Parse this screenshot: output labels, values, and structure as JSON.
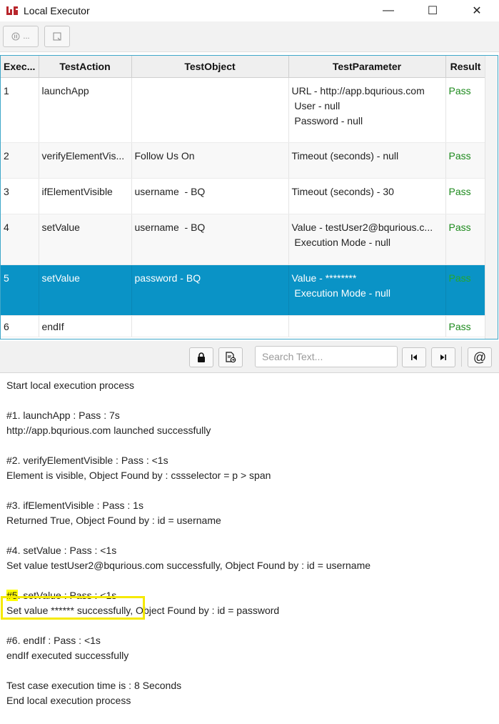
{
  "window": {
    "title": "Local Executor",
    "controls": [
      "—",
      "☐",
      "✕"
    ]
  },
  "toolbar": {
    "pause_label": "...",
    "save_icon": "save-icon"
  },
  "table": {
    "headers": [
      "Exec...",
      "TestAction",
      "TestObject",
      "TestParameter",
      "Result"
    ],
    "rows": [
      {
        "exec": "1",
        "action": "launchApp",
        "object": "",
        "params": [
          "URL - http://app.bqurious.com",
          " User - null",
          " Password - null"
        ],
        "result": "Pass"
      },
      {
        "exec": "2",
        "action": "verifyElementVis...",
        "object": "Follow Us On",
        "params": [
          "Timeout (seconds) - null"
        ],
        "result": "Pass"
      },
      {
        "exec": "3",
        "action": "ifElementVisible",
        "object": "username  - BQ",
        "params": [
          "Timeout (seconds) - 30"
        ],
        "result": "Pass"
      },
      {
        "exec": "4",
        "action": "setValue",
        "object": "username  - BQ",
        "params": [
          "Value - testUser2@bqurious.c...",
          " Execution Mode - null"
        ],
        "result": "Pass"
      },
      {
        "exec": "5",
        "action": "setValue",
        "object": "password - BQ",
        "params": [
          "Value - ********",
          " Execution Mode - null"
        ],
        "result": "Pass"
      },
      {
        "exec": "6",
        "action": "endIf",
        "object": "",
        "params": [
          ""
        ],
        "result": "Pass"
      }
    ]
  },
  "search": {
    "placeholder": "Search Text...",
    "at_label": "@"
  },
  "console": {
    "lines": [
      "Start local execution process",
      "",
      "#1. launchApp : Pass : 7s",
      "http://app.bqurious.com launched successfully",
      "",
      "#2. verifyElementVisible : Pass :  <1s",
      "Element is visible, Object Found by : cssselector = p > span",
      "",
      "#3. ifElementVisible : Pass : 1s",
      "Returned True, Object Found by : id = username",
      "",
      "#4. setValue : Pass :  <1s",
      "Set value testUser2@bqurious.com successfully, Object Found by : id = username",
      "",
      "#5. setValue : Pass :  <1s",
      "Set value ****** successfully, Object Found by : id = password",
      "",
      "#6. endIf : Pass :  <1s",
      "endIf executed successfully",
      "",
      "Test case execution time is : 8 Seconds",
      "End local execution process"
    ]
  },
  "colors": {
    "selected_row": "#0a93c6",
    "pass": "#1d8a1d",
    "highlight": "#ffff00",
    "border_accent": "#3fa7c9"
  }
}
